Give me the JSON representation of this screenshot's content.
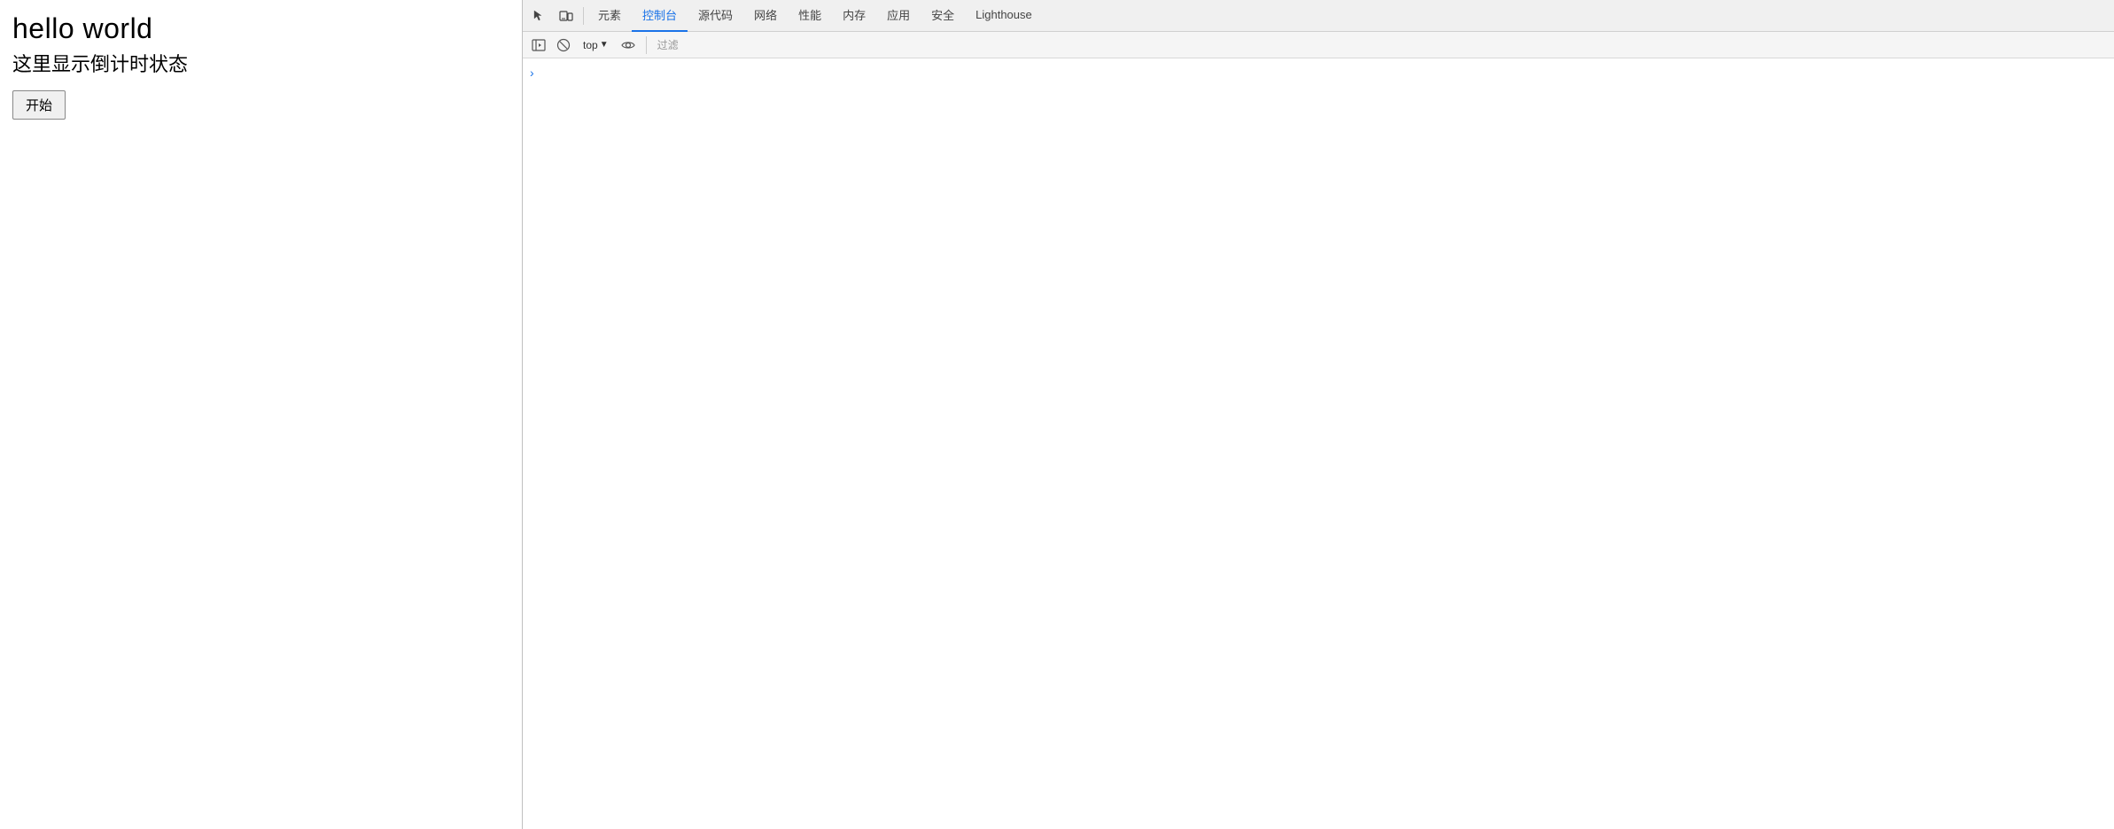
{
  "webpage": {
    "title": "hello world",
    "subtitle": "这里显示倒计时状态",
    "start_button_label": "开始"
  },
  "devtools": {
    "tabs": [
      {
        "id": "elements",
        "label": "元素",
        "active": false
      },
      {
        "id": "console",
        "label": "控制台",
        "active": true
      },
      {
        "id": "sources",
        "label": "源代码",
        "active": false
      },
      {
        "id": "network",
        "label": "网络",
        "active": false
      },
      {
        "id": "performance",
        "label": "性能",
        "active": false
      },
      {
        "id": "memory",
        "label": "内存",
        "active": false
      },
      {
        "id": "application",
        "label": "应用",
        "active": false
      },
      {
        "id": "security",
        "label": "安全",
        "active": false
      },
      {
        "id": "lighthouse",
        "label": "Lighthouse",
        "active": false
      }
    ],
    "console": {
      "top_dropdown": "top",
      "filter_placeholder": "过滤"
    }
  }
}
